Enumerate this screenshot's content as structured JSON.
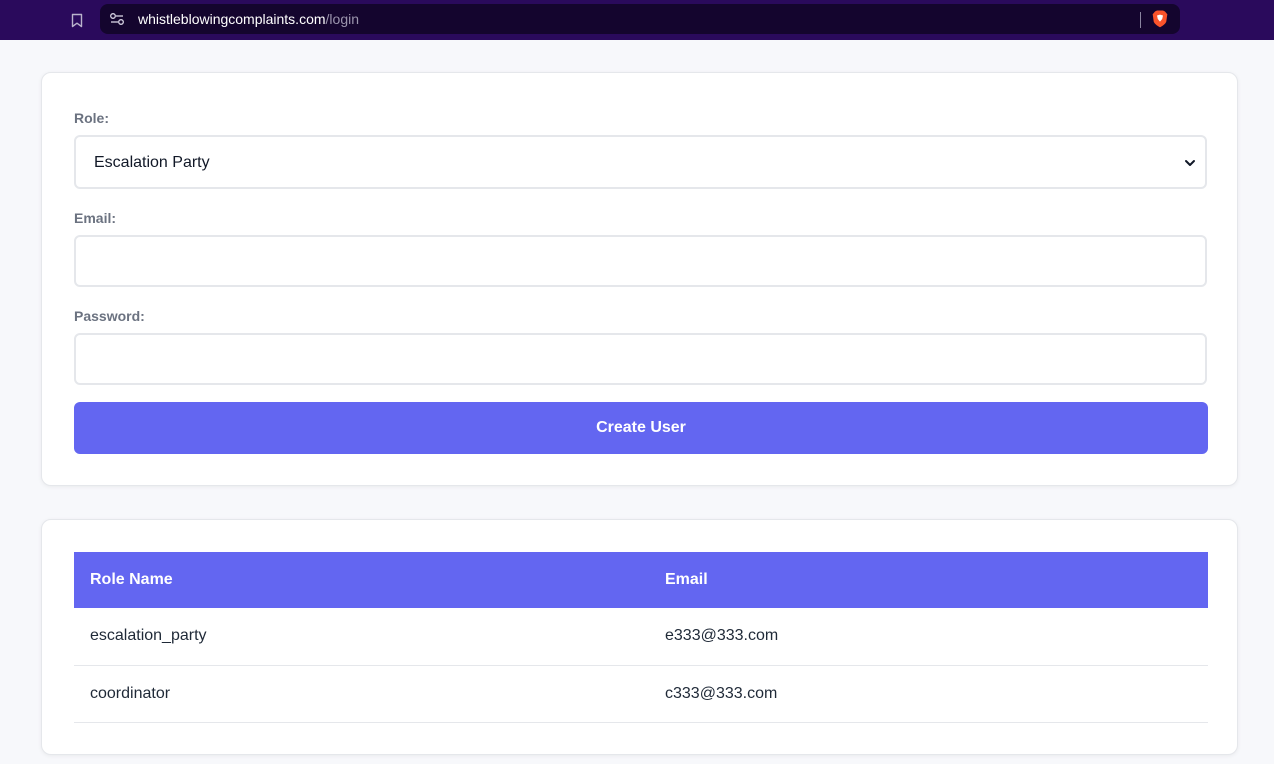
{
  "browser": {
    "url_host": "whistleblowingcomplaints.com",
    "url_path": "/login",
    "icons": [
      "bookmark-icon",
      "site-settings-icon",
      "brave-shield-icon"
    ]
  },
  "form": {
    "role_label": "Role:",
    "role_selected": "Escalation Party",
    "email_label": "Email:",
    "email_value": "",
    "password_label": "Password:",
    "password_value": "",
    "submit_label": "Create User"
  },
  "table": {
    "columns": [
      "Role Name",
      "Email"
    ],
    "rows": [
      {
        "role": "escalation_party",
        "email": "e333@333.com"
      },
      {
        "role": "coordinator",
        "email": "c333@333.com"
      }
    ]
  },
  "colors": {
    "accent": "#6366f1",
    "browser_bar": "#2a0a5c",
    "address_bar": "#14052e",
    "page_bg": "#f7f8fb"
  }
}
